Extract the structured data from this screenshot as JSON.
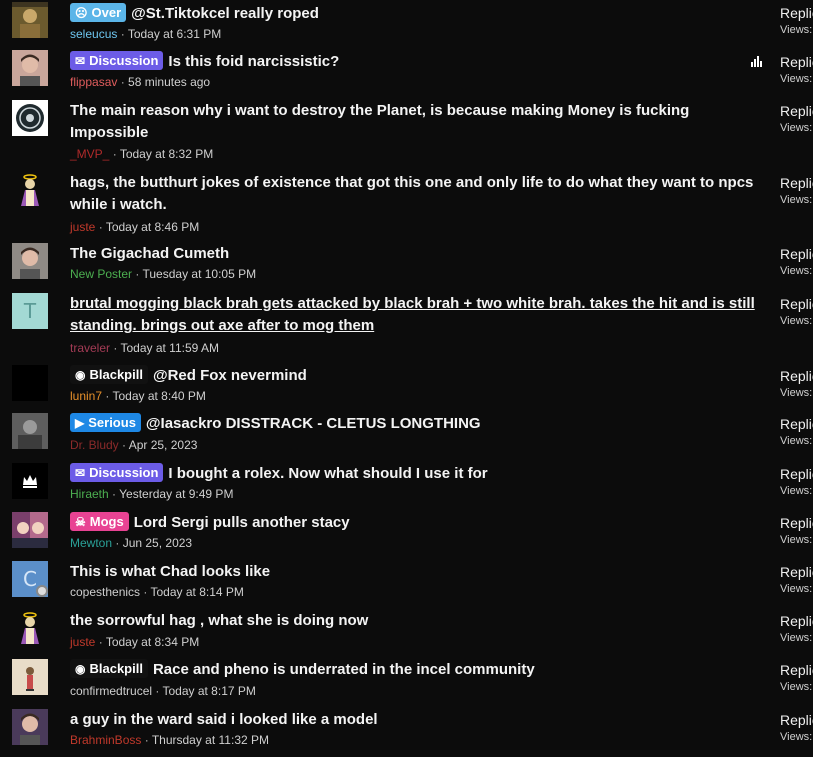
{
  "colors": {
    "bg": "#0c0c0c",
    "prefix_over": "#5bb5e8",
    "prefix_discussion": "#6c5ce7",
    "prefix_blackpill": "#111111",
    "prefix_serious": "#1e88e5",
    "prefix_mogs": "#e84393"
  },
  "threads": [
    {
      "title": "@St.Tiktokcel really roped",
      "prefix": {
        "label": "Over",
        "icon": "sad-face-icon",
        "color": "#5bb5e8"
      },
      "author": "seleucus",
      "author_color": "#6ec6f0",
      "time": "Today at 6:31 PM",
      "avatar": {
        "icon": "painting-avatar",
        "bg": "#6b5a2e"
      },
      "stats": {
        "replies": "Replie",
        "views": "Views:"
      },
      "underline": false,
      "analytics_icon": false
    },
    {
      "title": "Is this foid narcissistic?",
      "prefix": {
        "label": "Discussion",
        "icon": "chat-bubbles-icon",
        "color": "#6c5ce7"
      },
      "author": "flippasav",
      "author_color": "#e05d5d",
      "time": "58 minutes ago",
      "avatar": {
        "icon": "face-photo-avatar",
        "bg": "#c9a69b"
      },
      "stats": {
        "replies": "Replie",
        "views": "Views:"
      },
      "underline": false,
      "analytics_icon": true
    },
    {
      "title": "The main reason why i want to destroy the Planet, is because making Money is fucking Impossible",
      "prefix": null,
      "author": "_MVP_",
      "author_color": "#b02a2a",
      "time": "Today at 8:32 PM",
      "avatar": {
        "icon": "badge-avatar",
        "bg": "#ffffff"
      },
      "stats": {
        "replies": "Replie",
        "views": "Views:"
      },
      "underline": false,
      "analytics_icon": false
    },
    {
      "title": "hags, the butthurt jokes of existence that got this one and only life to do what they want to npcs while i watch.",
      "prefix": null,
      "author": "juste",
      "author_color": "#c0392b",
      "time": "Today at 8:46 PM",
      "avatar": {
        "icon": "saint-figure-avatar",
        "bg": "#0c0c0c"
      },
      "stats": {
        "replies": "Replie",
        "views": "Views:"
      },
      "underline": false,
      "analytics_icon": false
    },
    {
      "title": "The Gigachad Cumeth",
      "prefix": null,
      "author": "New Poster",
      "author_color": "#4caf50",
      "time": "Tuesday at 10:05 PM",
      "avatar": {
        "icon": "face-photo-avatar",
        "bg": "#8f8a85"
      },
      "stats": {
        "replies": "Replie",
        "views": "Views:"
      },
      "underline": false,
      "analytics_icon": false
    },
    {
      "title": "brutal mogging black brah gets attacked by black brah + two white brah. takes the hit and is still standing. brings out axe after to mog them",
      "prefix": null,
      "author": "traveler",
      "author_color": "#a33b55",
      "time": "Today at 11:59 AM",
      "avatar": {
        "icon": "letter-avatar",
        "letter": "T",
        "bg": "#a3d9d4",
        "fg": "#5b9b96"
      },
      "stats": {
        "replies": "Replie",
        "views": "Views:"
      },
      "underline": true,
      "analytics_icon": false
    },
    {
      "title": "@Red Fox nevermind",
      "prefix": {
        "label": "Blackpill",
        "icon": "gamepad-icon",
        "color": "#111111"
      },
      "author": "lunin7",
      "author_color": "#e8912a",
      "time": "Today at 8:40 PM",
      "avatar": {
        "icon": "black-avatar",
        "bg": "#000000"
      },
      "stats": {
        "replies": "Replie",
        "views": "Views:"
      },
      "underline": false,
      "analytics_icon": false
    },
    {
      "title": "@Iasackro DISSTRACK - CLETUS LONGTHING",
      "prefix": {
        "label": "Serious",
        "icon": "megaphone-icon",
        "color": "#1e88e5"
      },
      "author": "Dr. Bludy",
      "author_color": "#8b2a2a",
      "time": "Apr 25, 2023",
      "avatar": {
        "icon": "bw-photo-avatar",
        "bg": "#6a6a6a"
      },
      "stats": {
        "replies": "Replie",
        "views": "Views:"
      },
      "underline": false,
      "analytics_icon": false
    },
    {
      "title": "I bought a rolex. Now what should I use it for",
      "prefix": {
        "label": "Discussion",
        "icon": "chat-bubbles-icon",
        "color": "#6c5ce7"
      },
      "author": "Hiraeth",
      "author_color": "#4caf50",
      "time": "Yesterday at 9:49 PM",
      "avatar": {
        "icon": "crown-avatar",
        "bg": "#000000"
      },
      "stats": {
        "replies": "Replie",
        "views": "Views:"
      },
      "underline": false,
      "analytics_icon": false
    },
    {
      "title": "Lord Sergi pulls another stacy",
      "prefix": {
        "label": "Mogs",
        "icon": "skull-icon",
        "color": "#e84393"
      },
      "author": "Mewton",
      "author_color": "#2aa198",
      "time": "Jun 25, 2023",
      "avatar": {
        "icon": "anime-avatar",
        "bg": "#b46a8c"
      },
      "stats": {
        "replies": "Replie",
        "views": "Views:"
      },
      "underline": false,
      "analytics_icon": false
    },
    {
      "title": "This is what Chad looks like",
      "prefix": null,
      "author": "copesthenics",
      "author_color": "#cfcfcf",
      "time": "Today at 8:14 PM",
      "avatar": {
        "icon": "letter-avatar",
        "letter": "C",
        "bg": "#5b8fc9",
        "fg": "#d6e6f7"
      },
      "stats": {
        "replies": "Replie",
        "views": "Views:"
      },
      "underline": false,
      "analytics_icon": false
    },
    {
      "title": "the sorrowful hag , what she is doing now",
      "prefix": null,
      "author": "juste",
      "author_color": "#c0392b",
      "time": "Today at 8:34 PM",
      "avatar": {
        "icon": "saint-figure-avatar",
        "bg": "#0c0c0c"
      },
      "stats": {
        "replies": "Replie",
        "views": "Views:"
      },
      "underline": false,
      "analytics_icon": false
    },
    {
      "title": "Race and pheno is underrated in the incel community",
      "prefix": {
        "label": "Blackpill",
        "icon": "gamepad-icon",
        "color": "#111111"
      },
      "author": "confirmedtrucel",
      "author_color": "#cfcfcf",
      "time": "Today at 8:17 PM",
      "avatar": {
        "icon": "figure-avatar",
        "bg": "#e8dcc8"
      },
      "stats": {
        "replies": "Replie",
        "views": "Views:"
      },
      "underline": false,
      "analytics_icon": false
    },
    {
      "title": "a guy in the ward said i looked like a model",
      "prefix": null,
      "author": "BrahminBoss",
      "author_color": "#c0392b",
      "time": "Thursday at 11:32 PM",
      "avatar": {
        "icon": "face-photo-avatar",
        "bg": "#4a3a5a"
      },
      "stats": {
        "replies": "Replie",
        "views": "Views:"
      },
      "underline": false,
      "analytics_icon": false
    }
  ]
}
